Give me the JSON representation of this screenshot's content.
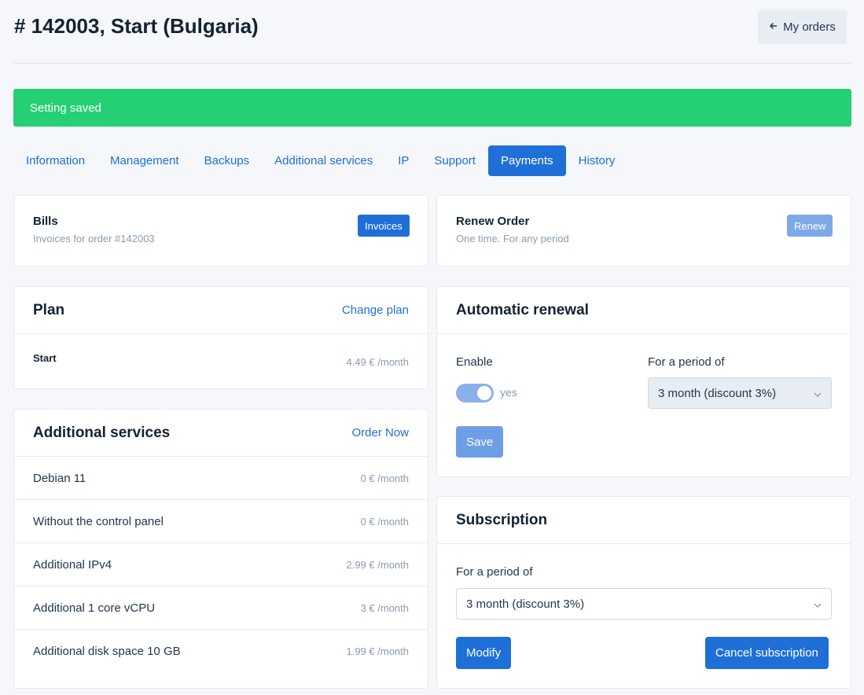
{
  "header": {
    "title": "# 142003, Start (Bulgaria)",
    "back_button": "My orders"
  },
  "alert": {
    "text": "Setting saved"
  },
  "tabs": [
    {
      "label": "Information"
    },
    {
      "label": "Management"
    },
    {
      "label": "Backups"
    },
    {
      "label": "Additional services"
    },
    {
      "label": "IP"
    },
    {
      "label": "Support"
    },
    {
      "label": "Payments",
      "active": true
    },
    {
      "label": "History"
    }
  ],
  "bills": {
    "title": "Bills",
    "subtitle": "Invoices for order #142003",
    "button": "Invoices"
  },
  "renew_order": {
    "title": "Renew Order",
    "subtitle": "One time. For any period",
    "button": "Renew"
  },
  "plan": {
    "title": "Plan",
    "action": "Change plan",
    "name": "Start",
    "price": "4.49 € /month"
  },
  "additional_services": {
    "title": "Additional services",
    "action": "Order Now",
    "items": [
      {
        "name": "Debian 11",
        "price": "0 € /month"
      },
      {
        "name": "Without the control panel",
        "price": "0 € /month"
      },
      {
        "name": "Additional IPv4",
        "price": "2.99 € /month"
      },
      {
        "name": "Additional 1 core vCPU",
        "price": "3 € /month"
      },
      {
        "name": "Additional disk space 10 GB",
        "price": "1.99 € /month"
      }
    ]
  },
  "auto_renewal": {
    "title": "Automatic renewal",
    "enable_label": "Enable",
    "toggle_text": "yes",
    "toggle_on": true,
    "period_label": "For a period of",
    "period_value": "3 month (discount 3%)",
    "save_button": "Save"
  },
  "subscription": {
    "title": "Subscription",
    "period_label": "For a period of",
    "period_value": "3 month (discount 3%)",
    "modify_button": "Modify",
    "cancel_button": "Cancel subscription"
  },
  "colors": {
    "primary": "#1f6fd9",
    "primary_light": "#6e9fe6",
    "success": "#25cf73",
    "link": "#1d6fd6"
  }
}
